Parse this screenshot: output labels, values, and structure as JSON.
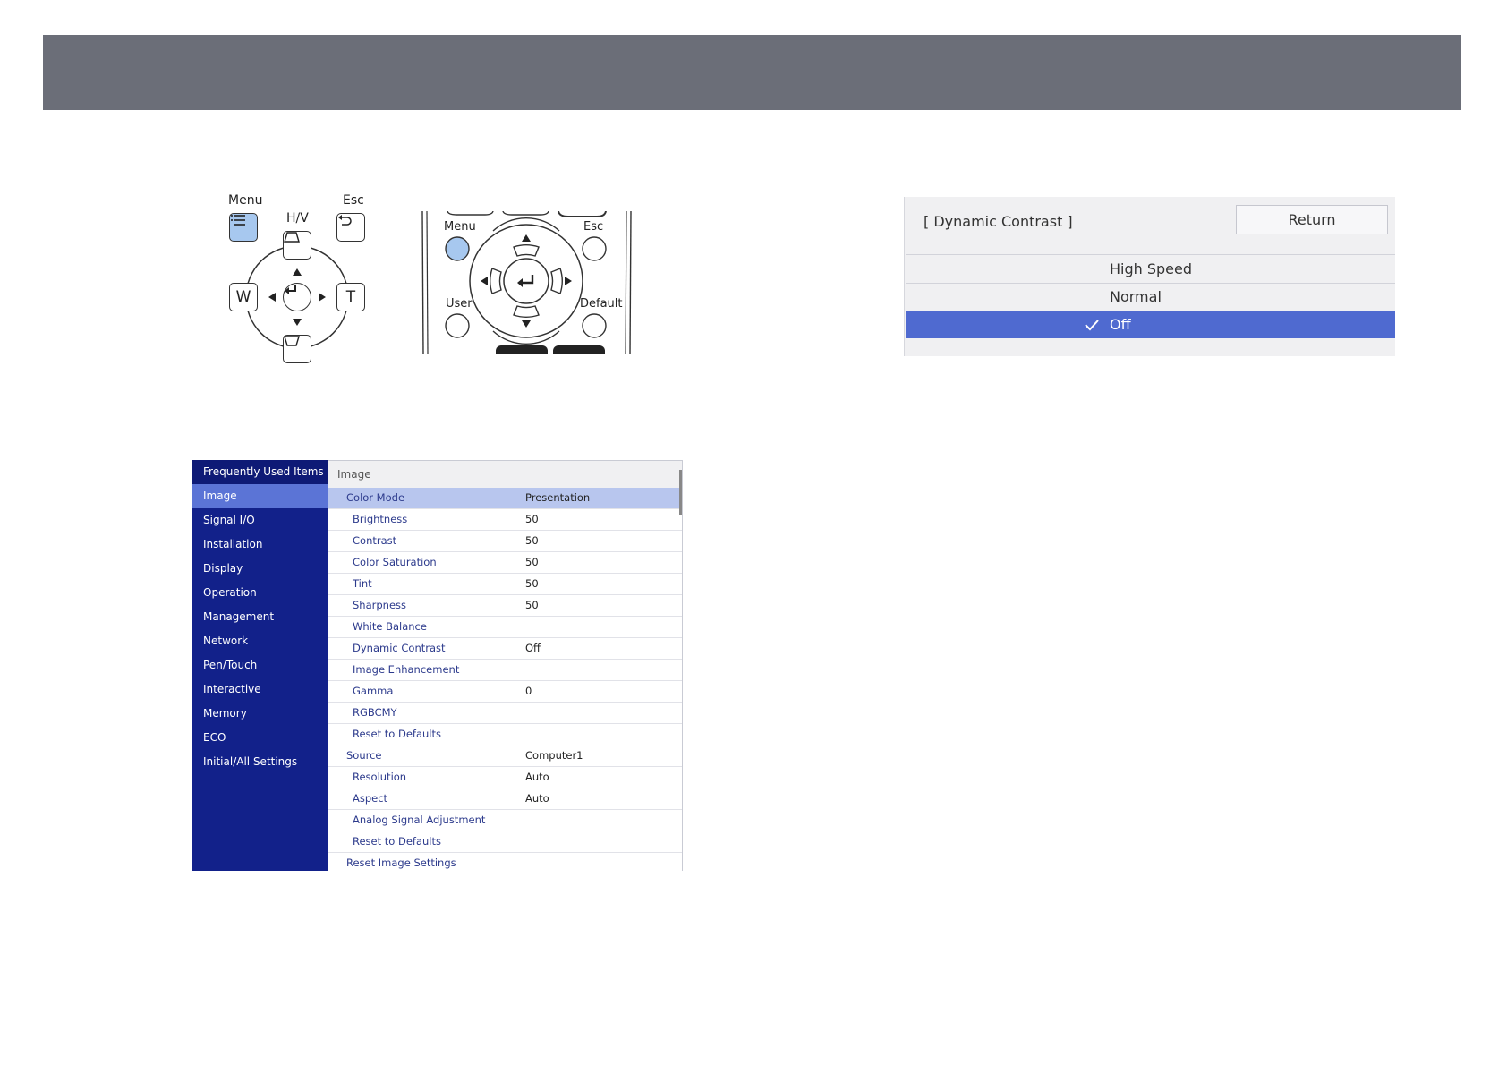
{
  "control_panel": {
    "menu_label": "Menu",
    "hv_label": "H/V",
    "esc_label": "Esc",
    "w_label": "W",
    "t_label": "T"
  },
  "remote": {
    "menu_label": "Menu",
    "esc_label": "Esc",
    "user_label": "User",
    "default_label": "Default",
    "menu_button_color": "#a7c8ef"
  },
  "settings_menu": {
    "sidebar": [
      "Frequently Used Items",
      "Image",
      "Signal I/O",
      "Installation",
      "Display",
      "Operation",
      "Management",
      "Network",
      "Pen/Touch",
      "Interactive",
      "Memory",
      "ECO",
      "Initial/All Settings"
    ],
    "active_index": 1,
    "panel_title": "Image",
    "rows": [
      {
        "name": "Color Mode",
        "value": "Presentation",
        "sub": false,
        "selected": true
      },
      {
        "name": "Brightness",
        "value": "50",
        "sub": true
      },
      {
        "name": "Contrast",
        "value": "50",
        "sub": true
      },
      {
        "name": "Color Saturation",
        "value": "50",
        "sub": true
      },
      {
        "name": "Tint",
        "value": "50",
        "sub": true
      },
      {
        "name": "Sharpness",
        "value": "50",
        "sub": true
      },
      {
        "name": "White Balance",
        "value": "",
        "sub": true
      },
      {
        "name": "Dynamic Contrast",
        "value": "Off",
        "sub": true
      },
      {
        "name": "Image Enhancement",
        "value": "",
        "sub": true
      },
      {
        "name": "Gamma",
        "value": "0",
        "sub": true
      },
      {
        "name": "RGBCMY",
        "value": "",
        "sub": true
      },
      {
        "name": "Reset to Defaults",
        "value": "",
        "sub": true
      },
      {
        "name": "Source",
        "value": "Computer1",
        "sub": false
      },
      {
        "name": "Resolution",
        "value": "Auto",
        "sub": true
      },
      {
        "name": "Aspect",
        "value": "Auto",
        "sub": true
      },
      {
        "name": "Analog Signal Adjustment",
        "value": "",
        "sub": true
      },
      {
        "name": "Reset to Defaults",
        "value": "",
        "sub": true
      },
      {
        "name": "Reset Image Settings",
        "value": "",
        "sub": false
      }
    ],
    "sidebar_color": "#12218a",
    "active_color": "#5b74d6"
  },
  "dialog": {
    "title": "[ Dynamic Contrast ]",
    "return_label": "Return",
    "options": [
      "High Speed",
      "Normal",
      "Off"
    ],
    "selected_index": 2,
    "selected_color": "#4f6ad0"
  }
}
